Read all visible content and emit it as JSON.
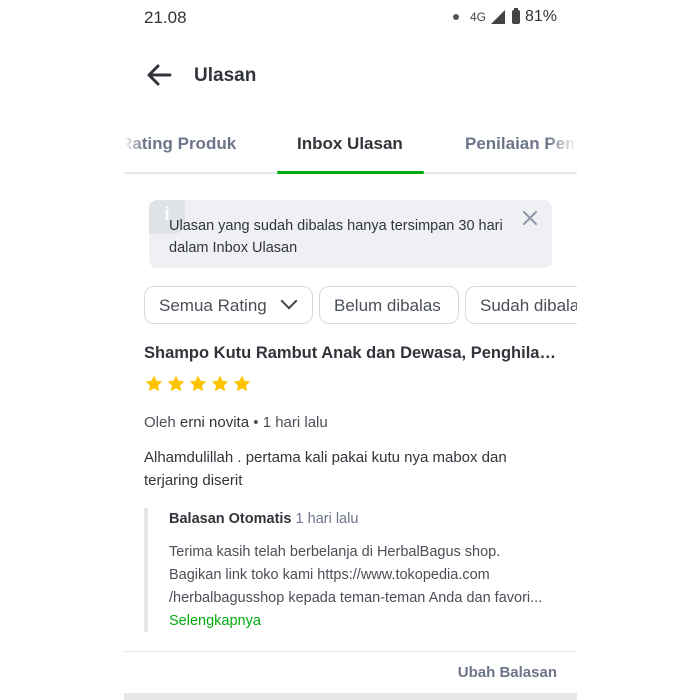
{
  "status": {
    "time": "21.08",
    "network": "4G",
    "battery": "81%"
  },
  "header": {
    "title": "Ulasan",
    "back_icon": "arrow-left-icon"
  },
  "tabs": [
    {
      "label": "Rating Produk",
      "active": false
    },
    {
      "label": "Inbox Ulasan",
      "active": true
    },
    {
      "label": "Penilaian Pembeli",
      "active": false
    }
  ],
  "info": {
    "text": "Ulasan yang sudah dibalas hanya tersimpan 30 hari dalam Inbox Ulasan",
    "icon": "info-icon"
  },
  "filters": [
    {
      "label": "Semua Rating"
    },
    {
      "label": "Belum dibalas"
    },
    {
      "label": "Sudah dibalas"
    }
  ],
  "review": {
    "product": "Shampo Kutu Rambut Anak dan Dewasa, Penghilang Kutu",
    "rating": 5,
    "by_prefix": "Oleh",
    "reviewer": "erni novita",
    "time": "1 hari lalu",
    "text": "Alhamdulillah . pertama kali pakai kutu nya mabox dan terjaring diserit"
  },
  "reply": {
    "title": "Balasan Otomatis",
    "time": "1 hari lalu",
    "text": "Terima kasih telah berbelanja di HerbalBagus shop. Bagikan link toko kami https://www.tokopedia.com /herbalbagusshop kepada teman-teman Anda dan favori...",
    "more_label": "Selengkapnya"
  },
  "actions": {
    "edit_reply": "Ubah Balasan"
  },
  "colors": {
    "accent": "#03ac0e",
    "star": "#ffc400"
  }
}
